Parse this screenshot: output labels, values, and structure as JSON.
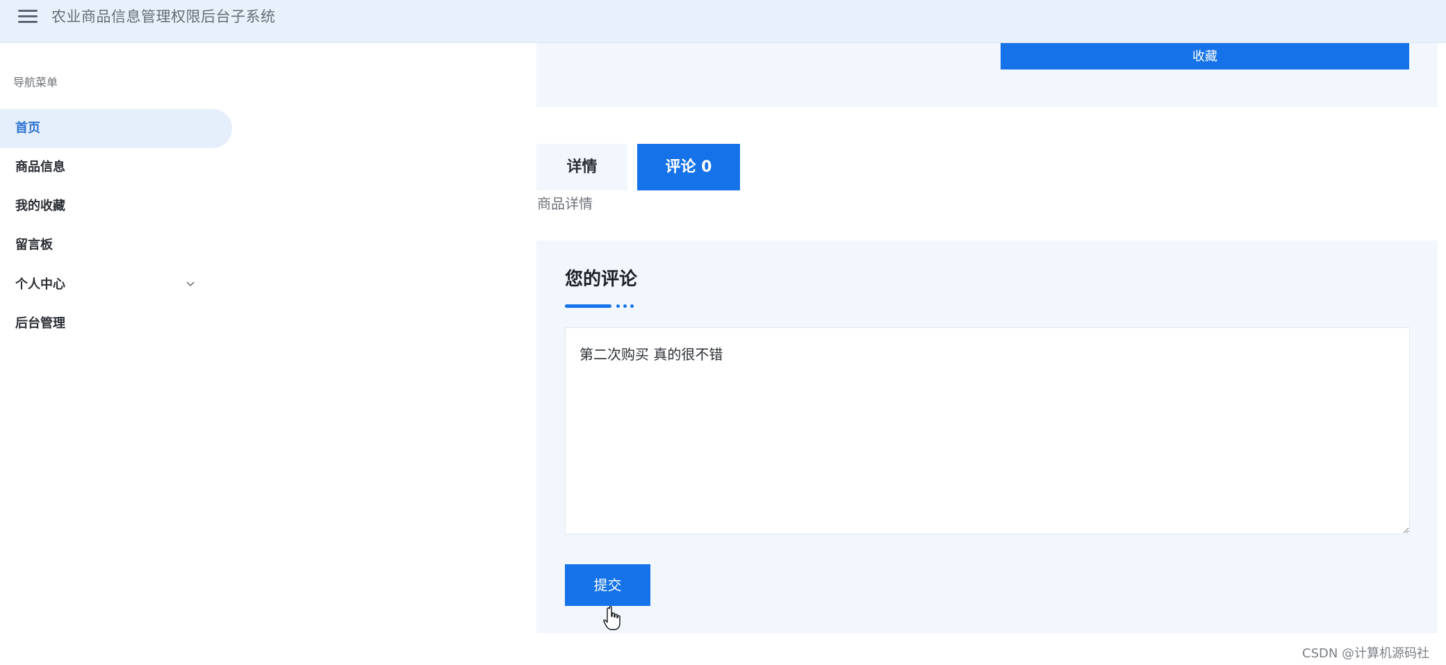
{
  "header": {
    "title": "农业商品信息管理权限后台子系统",
    "menu_icon": "hamburger-menu-icon"
  },
  "sidebar": {
    "caption": "导航菜单",
    "items": [
      {
        "label": "首页",
        "active": true
      },
      {
        "label": "商品信息"
      },
      {
        "label": "我的收藏"
      },
      {
        "label": "留言板"
      },
      {
        "label": "个人中心",
        "expandable": true
      },
      {
        "label": "后台管理"
      }
    ]
  },
  "product": {
    "collect_label": "收藏"
  },
  "tabs": [
    {
      "label": "详情",
      "active": false
    },
    {
      "label": "评论 0",
      "active": true
    }
  ],
  "detail": {
    "text": "商品详情"
  },
  "comment": {
    "title": "您的评论",
    "value": "第二次购买 真的很不错",
    "submit_label": "提交"
  },
  "watermark": "CSDN @计算机源码社",
  "colors": {
    "accent": "#1572e8",
    "header_bg": "#e8f0fb",
    "panel_bg": "#f2f6fd",
    "active_nav_bg": "#e5eefb",
    "active_nav_text": "#2a72d4"
  }
}
